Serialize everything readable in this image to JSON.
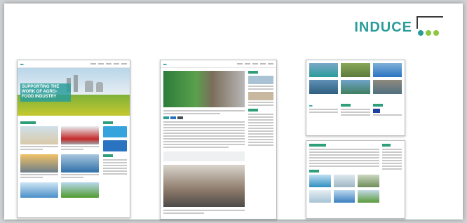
{
  "logo": {
    "text": "INDUCE",
    "dot_colors": [
      "#2a9d9a",
      "#8dc63f",
      "#8dc63f"
    ]
  },
  "screens": {
    "home": {
      "hero_text": "SUPPORTING THE WORK OF AGRO-FOOD INDUSTRY"
    }
  },
  "colors": {
    "accent": "#2a9d9a",
    "green": "#2e9e7b",
    "background": "#cfd2d4"
  }
}
